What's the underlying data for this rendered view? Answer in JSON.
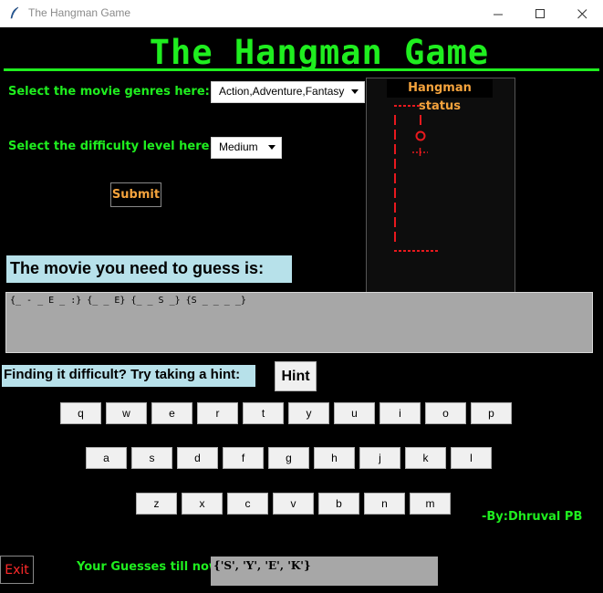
{
  "window": {
    "title": "The Hangman Game"
  },
  "header": {
    "title": "The Hangman Game"
  },
  "controls": {
    "genre_label": "Select the movie genres here:",
    "genre_value": "Action,Adventure,Fantasy",
    "difficulty_label": "Select the difficulty level here:",
    "difficulty_value": "Medium",
    "submit_label": "Submit"
  },
  "status": {
    "label": "Hangman status"
  },
  "puzzle": {
    "label": "The movie you need to guess is:",
    "masked_title": "{_ - _ E _ :} {_ _ E} {_ _ S _} {S _ _ _ _}"
  },
  "hint": {
    "label": "Finding it difficult? Try taking a hint:",
    "button": "Hint"
  },
  "keyboard": {
    "rows": [
      [
        "q",
        "w",
        "e",
        "r",
        "t",
        "y",
        "u",
        "i",
        "o",
        "p"
      ],
      [
        "a",
        "s",
        "d",
        "f",
        "g",
        "h",
        "j",
        "k",
        "l"
      ],
      [
        "z",
        "x",
        "c",
        "v",
        "b",
        "n",
        "m"
      ]
    ]
  },
  "credit": "-By:Dhruval PB",
  "footer": {
    "exit": "Exit",
    "guesses_label": "Your Guesses till now:",
    "guesses_value": "{'S', 'Y', 'E', 'K'}"
  },
  "colors": {
    "accent_green": "#1fee1f",
    "accent_orange": "#f5a33d",
    "hangman_red": "#e8191e",
    "label_cyan": "#b7e1ea"
  }
}
